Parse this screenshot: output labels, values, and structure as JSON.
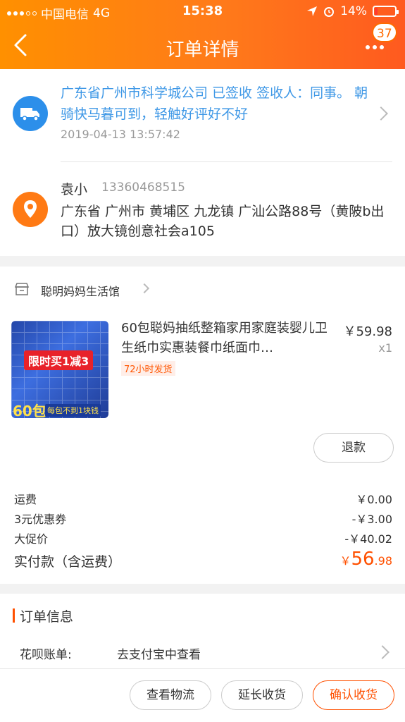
{
  "status_bar": {
    "carrier": "中国电信",
    "network": "4G",
    "time": "15:38",
    "battery_percent": "14%",
    "battery_level": 0.14
  },
  "nav": {
    "title": "订单详情",
    "badge_count": "37"
  },
  "logistics": {
    "message": "广东省广州市科学城公司 已签收 签收人：同事。 朝骑快马暮可到，轻触好评好不好",
    "time": "2019-04-13 13:57:42"
  },
  "address": {
    "name": "袁小",
    "phone": "13360468515",
    "detail": "广东省 广州市 黄埔区 九龙镇 广汕公路88号（黄陂b出口）放大镜创意社会a105"
  },
  "shop": {
    "name": "聪明妈妈生活馆"
  },
  "product": {
    "title": "60包聪妈抽纸整箱家用家庭装婴儿卫生纸巾实惠装餐巾纸面巾…",
    "price": "￥59.98",
    "quantity": "x1",
    "tag": "72小时发货",
    "image_text": {
      "promo": "限时买1减3",
      "count": "60包",
      "sub": "每包不到1块钱"
    }
  },
  "actions": {
    "refund": "退款"
  },
  "fees": [
    {
      "label": "运费",
      "value": "￥0.00"
    },
    {
      "label": "3元优惠券",
      "value": "-￥3.00"
    },
    {
      "label": "大促价",
      "value": "-￥40.02"
    }
  ],
  "paid": {
    "label": "实付款（含运费）",
    "currency": "￥",
    "integer": "56",
    "decimal": ".98"
  },
  "order_info": {
    "title": "订单信息",
    "huabei_label": "花呗账单:",
    "huabei_value": "去支付宝中查看"
  },
  "bottom_buttons": {
    "logistics": "查看物流",
    "extend": "延长收货",
    "confirm": "确认收货"
  },
  "colors": {
    "accent": "#ff5000",
    "header_start": "#ff9000",
    "link_blue": "#3d97e6"
  }
}
